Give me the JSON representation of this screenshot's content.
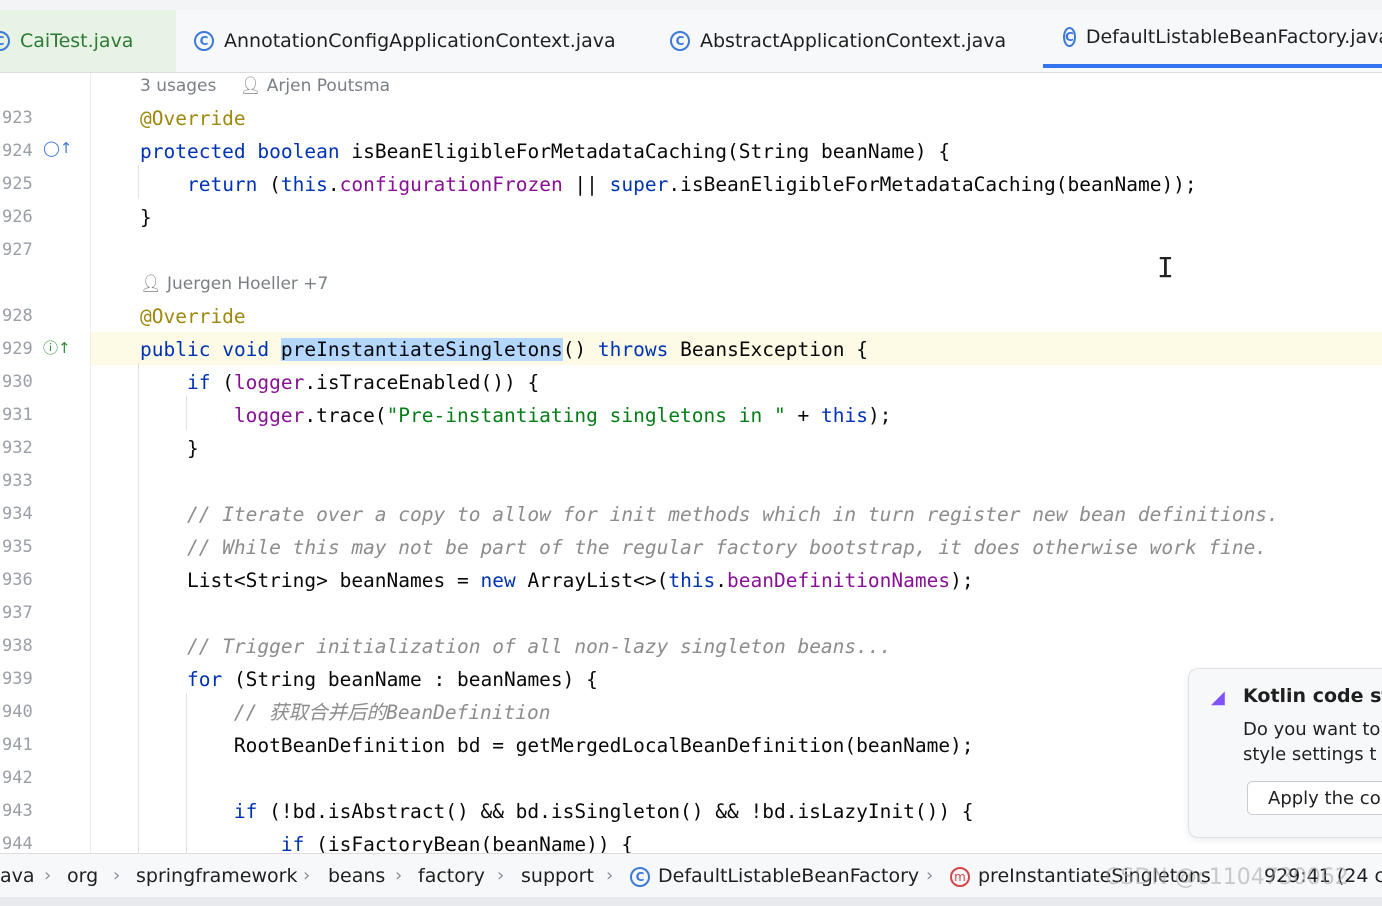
{
  "tabs": [
    {
      "label": "CaiTest.java",
      "icon": "class-icon",
      "state": "partial"
    },
    {
      "label": "AnnotationConfigApplicationContext.java",
      "icon": "class-icon"
    },
    {
      "label": "AbstractApplicationContext.java",
      "icon": "class-icon"
    },
    {
      "label": "DefaultListableBeanFactory.java",
      "icon": "class-icon",
      "state": "active"
    }
  ],
  "hints": {
    "first": {
      "usages": "3 usages",
      "author": "Arjen Poutsma"
    },
    "second": {
      "author": "Juergen Hoeller +7"
    }
  },
  "lines": [
    {
      "num": "923",
      "segments": [
        {
          "t": "@Override",
          "c": "ann"
        }
      ]
    },
    {
      "num": "924",
      "segments": [
        {
          "t": "protected",
          "c": "kw"
        },
        {
          "t": " "
        },
        {
          "t": "boolean",
          "c": "kw"
        },
        {
          "t": " isBeanEligibleForMetadataCaching(String beanName) {"
        }
      ]
    },
    {
      "num": "925",
      "segments": [
        {
          "t": "    "
        },
        {
          "t": "return",
          "c": "kw"
        },
        {
          "t": " ("
        },
        {
          "t": "this",
          "c": "kw"
        },
        {
          "t": "."
        },
        {
          "t": "configurationFrozen",
          "c": "fld"
        },
        {
          "t": " || "
        },
        {
          "t": "super",
          "c": "kw"
        },
        {
          "t": ".isBeanEligibleForMetadataCaching(beanName));"
        }
      ]
    },
    {
      "num": "926",
      "segments": [
        {
          "t": "}"
        }
      ]
    },
    {
      "num": "927",
      "segments": []
    },
    {
      "num": "928",
      "segments": [
        {
          "t": "@Override",
          "c": "ann"
        }
      ]
    },
    {
      "num": "929",
      "segments": [
        {
          "t": "public",
          "c": "kw"
        },
        {
          "t": " "
        },
        {
          "t": "void",
          "c": "kw"
        },
        {
          "t": " "
        },
        {
          "t": "preInstantiateSingletons",
          "c": "hl"
        },
        {
          "t": "() "
        },
        {
          "t": "throws",
          "c": "kw"
        },
        {
          "t": " BeansException {"
        }
      ]
    },
    {
      "num": "930",
      "segments": [
        {
          "t": "    "
        },
        {
          "t": "if",
          "c": "kw"
        },
        {
          "t": " ("
        },
        {
          "t": "logger",
          "c": "fld"
        },
        {
          "t": ".isTraceEnabled()) {"
        }
      ]
    },
    {
      "num": "931",
      "segments": [
        {
          "t": "        "
        },
        {
          "t": "logger",
          "c": "fld"
        },
        {
          "t": ".trace("
        },
        {
          "t": "\"Pre-instantiating singletons in \"",
          "c": "str"
        },
        {
          "t": " + "
        },
        {
          "t": "this",
          "c": "kw"
        },
        {
          "t": ");"
        }
      ]
    },
    {
      "num": "932",
      "segments": [
        {
          "t": "    }"
        }
      ]
    },
    {
      "num": "933",
      "segments": []
    },
    {
      "num": "934",
      "segments": [
        {
          "t": "    "
        },
        {
          "t": "// Iterate over a copy to allow for init methods which in turn register new bean definitions.",
          "c": "cmt"
        }
      ]
    },
    {
      "num": "935",
      "segments": [
        {
          "t": "    "
        },
        {
          "t": "// While this may not be part of the regular factory bootstrap, it does otherwise work fine.",
          "c": "cmt"
        }
      ]
    },
    {
      "num": "936",
      "segments": [
        {
          "t": "    List<String> beanNames = "
        },
        {
          "t": "new",
          "c": "kw"
        },
        {
          "t": " ArrayList<>("
        },
        {
          "t": "this",
          "c": "kw"
        },
        {
          "t": "."
        },
        {
          "t": "beanDefinitionNames",
          "c": "fld"
        },
        {
          "t": ");"
        }
      ]
    },
    {
      "num": "937",
      "segments": []
    },
    {
      "num": "938",
      "segments": [
        {
          "t": "    "
        },
        {
          "t": "// Trigger initialization of all non-lazy singleton beans...",
          "c": "cmt"
        }
      ]
    },
    {
      "num": "939",
      "segments": [
        {
          "t": "    "
        },
        {
          "t": "for",
          "c": "kw"
        },
        {
          "t": " (String beanName : beanNames) {"
        }
      ]
    },
    {
      "num": "940",
      "segments": [
        {
          "t": "        "
        },
        {
          "t": "// 获取合并后的BeanDefinition",
          "c": "cmt"
        }
      ]
    },
    {
      "num": "941",
      "segments": [
        {
          "t": "        RootBeanDefinition bd = getMergedLocalBeanDefinition(beanName);"
        }
      ]
    },
    {
      "num": "942",
      "segments": []
    },
    {
      "num": "943",
      "segments": [
        {
          "t": "        "
        },
        {
          "t": "if",
          "c": "kw"
        },
        {
          "t": " (!bd.isAbstract() && bd.isSingleton() && !bd.isLazyInit()) {"
        }
      ]
    },
    {
      "num": "944",
      "segments": [
        {
          "t": "            "
        },
        {
          "t": "if",
          "c": "kw"
        },
        {
          "t": " (isFactoryBean(beanName)) {"
        }
      ]
    }
  ],
  "notification": {
    "title": "Kotlin code st",
    "body_line1": "Do you want to",
    "body_line2": "style settings t",
    "button": "Apply the co"
  },
  "breadcrumbs": [
    "ava",
    "org",
    "springframework",
    "beans",
    "factory",
    "support",
    "DefaultListableBeanFactory",
    "preInstantiateSingletons"
  ],
  "status": {
    "position": "929:41 (24 c"
  },
  "watermark": "CSDN @c1104730062",
  "colors": {
    "keyword": "#0033b3",
    "annotation": "#9e880d",
    "field": "#871094",
    "string": "#067d17",
    "comment": "#8c8c8c",
    "selection": "#b4d7ff",
    "accent": "#3574f0"
  }
}
